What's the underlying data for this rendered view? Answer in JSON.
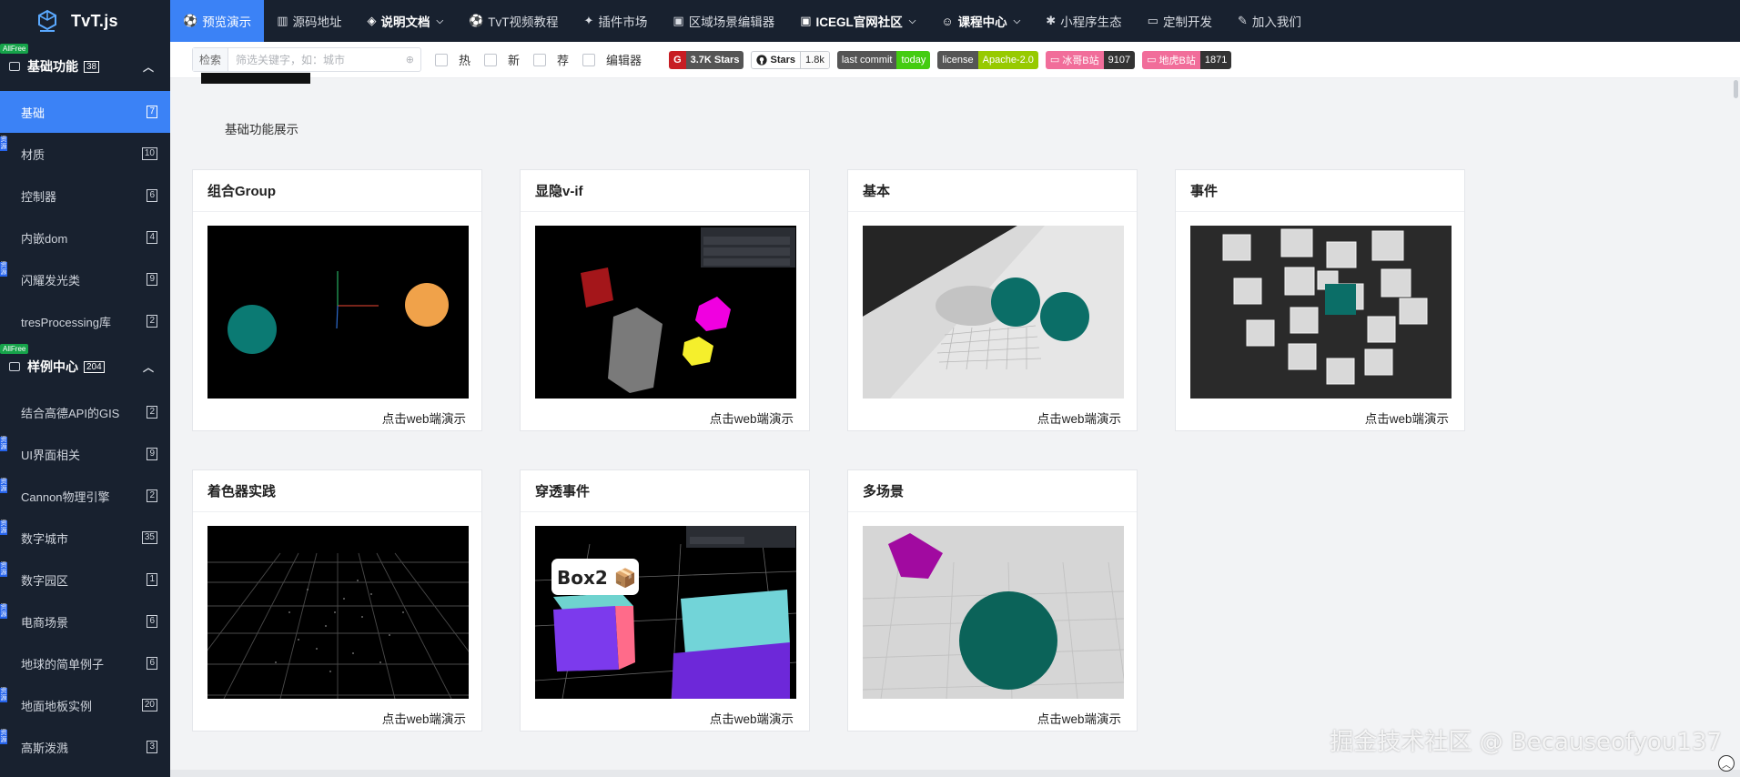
{
  "brand": {
    "name": "TvT.js"
  },
  "nav": [
    {
      "label": "预览演示",
      "icon": "⚽",
      "active": true
    },
    {
      "label": "源码地址",
      "icon": "▥"
    },
    {
      "label": "说明文档",
      "icon": "◈",
      "chevron": "⌵"
    },
    {
      "label": "TvT视频教程",
      "icon": "⚽"
    },
    {
      "label": "插件市场",
      "icon": "✦"
    },
    {
      "label": "区域场景编辑器",
      "icon": "▣"
    },
    {
      "label": "ICEGL官网社区",
      "icon": "▣",
      "chevron": "⌵"
    },
    {
      "label": "课程中心",
      "icon": "☺",
      "chevron": "⌵"
    },
    {
      "label": "小程序生态",
      "icon": "✱"
    },
    {
      "label": "定制开发",
      "icon": "▭"
    },
    {
      "label": "加入我们",
      "icon": "✎"
    }
  ],
  "sidebar": {
    "groups": [
      {
        "label": "基础功能",
        "count": "38",
        "tag": "AllFree",
        "collapse": "︿",
        "items": [
          {
            "label": "基础",
            "count": "7",
            "active": true
          },
          {
            "label": "材质",
            "count": "10",
            "edge": "资源"
          },
          {
            "label": "控制器",
            "count": "6"
          },
          {
            "label": "内嵌dom",
            "count": "4"
          },
          {
            "label": "闪耀发光类",
            "count": "9",
            "edge": "资源"
          },
          {
            "label": "tresProcessing库",
            "count": "2"
          }
        ]
      },
      {
        "label": "样例中心",
        "count": "204",
        "tag": "AllFree",
        "collapse": "︿",
        "items": [
          {
            "label": "结合高德API的GIS",
            "count": "2"
          },
          {
            "label": "UI界面相关",
            "count": "9",
            "edge": "资源"
          },
          {
            "label": "Cannon物理引擎",
            "count": "2",
            "edge": "资源"
          },
          {
            "label": "数字城市",
            "count": "35",
            "edge": "资源"
          },
          {
            "label": "数字园区",
            "count": "1",
            "edge": "资源"
          },
          {
            "label": "电商场景",
            "count": "6",
            "edge": "资源"
          },
          {
            "label": "地球的简单例子",
            "count": "6"
          },
          {
            "label": "地面地板实例",
            "count": "20",
            "edge": "资源"
          },
          {
            "label": "高斯泼溅",
            "count": "3",
            "edge": "资源"
          }
        ]
      }
    ]
  },
  "filter": {
    "search_label": "检索",
    "search_placeholder": "筛选关键字，如：城市",
    "search_icon": "⊕",
    "checkboxes": [
      "热",
      "新",
      "荐",
      "编辑器"
    ],
    "badges": {
      "gitee": {
        "left": "G",
        "right": "3.7K Stars"
      },
      "github": {
        "left": "Stars",
        "right": "1.8k"
      },
      "commit": {
        "left": "last commit",
        "right": "today"
      },
      "license": {
        "left": "license",
        "right": "Apache-2.0"
      },
      "bili1": {
        "left": "冰哥B站",
        "right": "9107"
      },
      "bili2": {
        "left": "地虎B站",
        "right": "1871"
      }
    }
  },
  "main": {
    "section_desc": "基础功能展示",
    "cards": [
      {
        "title": "组合Group",
        "link": "点击web端演示"
      },
      {
        "title": "显隐v-if",
        "link": "点击web端演示"
      },
      {
        "title": "基本",
        "link": "点击web端演示"
      },
      {
        "title": "事件",
        "link": "点击web端演示"
      },
      {
        "title": "着色器实践",
        "link": "点击web端演示"
      },
      {
        "title": "穿透事件",
        "link": "点击web端演示",
        "overlay_text": "Box2 📦"
      },
      {
        "title": "多场景",
        "link": "点击web端演示"
      }
    ]
  },
  "watermark": "掘金技术社区 @ Becauseofyou137",
  "colors": {
    "nav_bg": "#18212f",
    "accent": "#3b82f6",
    "allfree": "#16a34a",
    "teal": "#0b7a73",
    "orange": "#f0a24a"
  }
}
